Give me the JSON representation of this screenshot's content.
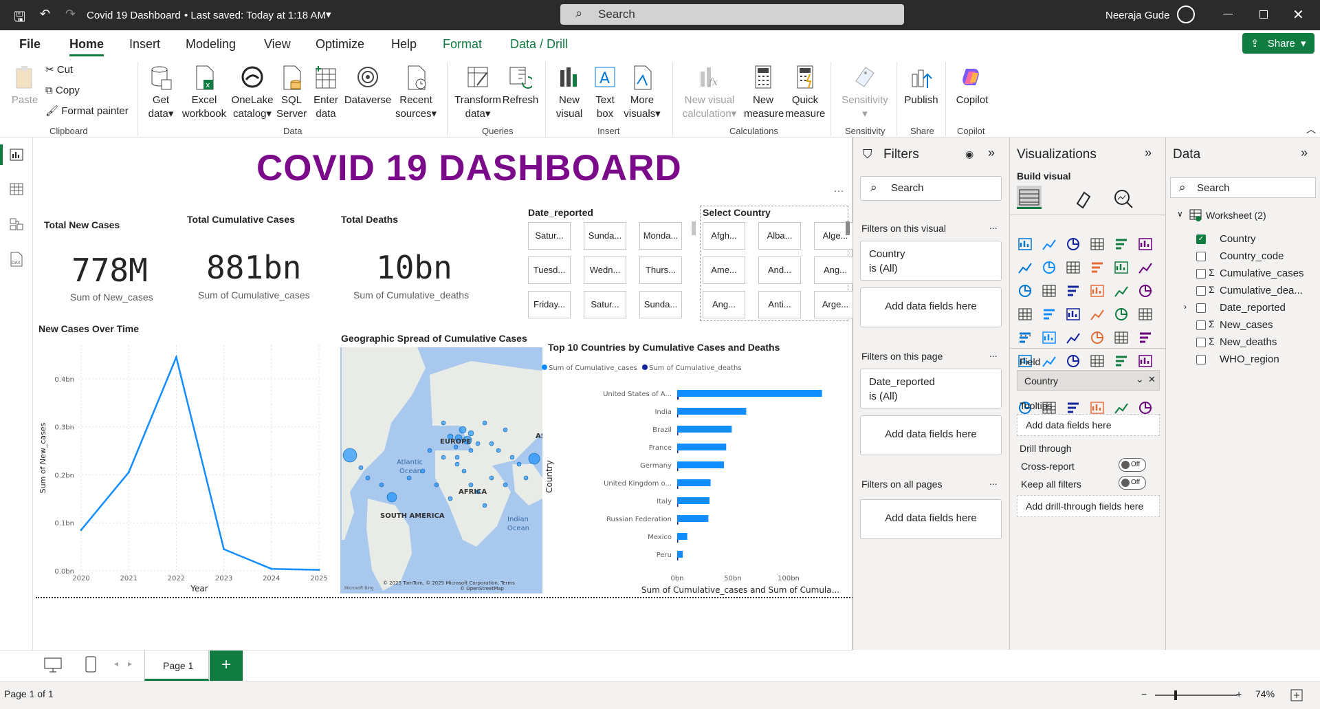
{
  "titlebar": {
    "doc_title": "Covid 19 Dashboard",
    "saved": "•  Last saved: Today at 1:18 AM",
    "search": "Search",
    "user": "Neeraja Gude"
  },
  "menu": {
    "file": "File",
    "home": "Home",
    "insert": "Insert",
    "modeling": "Modeling",
    "view": "View",
    "optimize": "Optimize",
    "help": "Help",
    "format": "Format",
    "data_drill": "Data / Drill",
    "share": "Share"
  },
  "ribbon": {
    "paste": "Paste",
    "cut": "Cut",
    "copy": "Copy",
    "format_painter": "Format painter",
    "clipboard": "Clipboard",
    "get_data": [
      "Get",
      "data"
    ],
    "excel": [
      "Excel",
      "workbook"
    ],
    "onelake": [
      "OneLake",
      "catalog"
    ],
    "sql": [
      "SQL",
      "Server"
    ],
    "enter_data": [
      "Enter",
      "data"
    ],
    "dataverse": "Dataverse",
    "recent": [
      "Recent",
      "sources"
    ],
    "data_group": "Data",
    "transform": [
      "Transform",
      "data"
    ],
    "refresh": "Refresh",
    "queries": "Queries",
    "new_visual": [
      "New",
      "visual"
    ],
    "text_box": [
      "Text",
      "box"
    ],
    "more_visuals": [
      "More",
      "visuals"
    ],
    "insert_group": "Insert",
    "new_visual_calc": [
      "New visual",
      "calculation"
    ],
    "new_measure": [
      "New",
      "measure"
    ],
    "quick_measure": [
      "Quick",
      "measure"
    ],
    "calc_group": "Calculations",
    "sensitivity": "Sensitivity",
    "sensitivity_group": "Sensitivity",
    "publish": "Publish",
    "share_group": "Share",
    "copilot": "Copilot",
    "copilot_group": "Copilot"
  },
  "report": {
    "title": "COVID 19 DASHBOARD",
    "cards": [
      {
        "title": "Total New Cases",
        "value": "778M",
        "sub": "Sum of New_cases"
      },
      {
        "title": "Total Cumulative Cases",
        "value": "881bn",
        "sub": "Sum of Cumulative_cases"
      },
      {
        "title": "Total Deaths",
        "value": "10bn",
        "sub": "Sum of Cumulative_deaths"
      }
    ],
    "date_slicer": {
      "title": "Date_reported",
      "items": [
        "Satur...",
        "Sunda...",
        "Monda...",
        "Tuesd...",
        "Wedn...",
        "Thurs...",
        "Friday...",
        "Satur...",
        "Sunda..."
      ]
    },
    "country_slicer": {
      "title": "Select Country",
      "items": [
        "Afgh...",
        "Alba...",
        "Alge...",
        "Ame...",
        "And...",
        "Ang...",
        "Ang...",
        "Anti...",
        "Arge..."
      ]
    },
    "map": {
      "title": "Geographic Spread of Cumulative Cases",
      "labels": [
        "EUROPE",
        "AS",
        "Atlantic",
        "Ocean",
        "AFRICA",
        "SOUTH AMERICA",
        "Indian",
        "Ocean"
      ],
      "credit": "© 2025 TomTom, © 2025 Microsoft Corporation, Terms",
      "credit2": "© OpenStreetMap",
      "bing": "Microsoft Bing"
    }
  },
  "chart_data": [
    {
      "type": "line",
      "title": "New Cases Over Time",
      "xlabel": "Year",
      "ylabel": "Sum of New_cases",
      "x": [
        "2020",
        "2021",
        "2022",
        "2023",
        "2024",
        "2025"
      ],
      "values": [
        0.085,
        0.205,
        0.445,
        0.045,
        0.004,
        0.002
      ],
      "unit": "bn",
      "yticks": [
        "0.0bn",
        "0.1bn",
        "0.2bn",
        "0.3bn",
        "0.4bn"
      ],
      "ylim": [
        0,
        0.47
      ],
      "color": "#118dff"
    },
    {
      "type": "bar",
      "title": "Top 10 Countries by Cumulative Cases and Deaths",
      "xlabel": "Sum of Cumulative_cases and Sum of Cumula...",
      "ylabel": "Country",
      "categories": [
        "United States of A...",
        "India",
        "Brazil",
        "France",
        "Germany",
        "United Kingdom o...",
        "Italy",
        "Russian Federation",
        "Mexico",
        "Peru"
      ],
      "series": [
        {
          "name": "Sum of Cumulative_cases",
          "values": [
            130,
            62,
            49,
            44,
            42,
            30,
            29,
            28,
            9,
            5
          ],
          "color": "#118dff"
        },
        {
          "name": "Sum of Cumulative_deaths",
          "values": [
            1.4,
            0.6,
            0.8,
            0.2,
            0.2,
            0.2,
            0.2,
            0.4,
            0.4,
            0.25
          ],
          "color": "#12239e"
        }
      ],
      "xticks": [
        "0bn",
        "50bn",
        "100bn"
      ],
      "xlim": [
        0,
        150
      ],
      "unit": "bn"
    }
  ],
  "filters": {
    "title": "Filters",
    "search": "Search",
    "on_visual": "Filters on this visual",
    "f1_field": "Country",
    "f1_state": "is (All)",
    "add": "Add data fields here",
    "on_page": "Filters on this page",
    "f2_field": "Date_reported",
    "f2_state": "is (All)",
    "all_pages": "Filters on all pages",
    "more": "..."
  },
  "viz": {
    "title": "Visualizations",
    "build": "Build visual",
    "field_label": "Field",
    "field_value": "Country",
    "tooltips": "Tooltips",
    "add": "Add data fields here",
    "drill": "Drill through",
    "cross": "Cross-report",
    "keep": "Keep all filters",
    "off": "Off",
    "add_drill": "Add drill-through fields here",
    "more": "..."
  },
  "datapane": {
    "title": "Data",
    "search": "Search",
    "table": "Worksheet (2)",
    "fields": [
      {
        "name": "Country",
        "checked": true,
        "sigma": false
      },
      {
        "name": "Country_code",
        "checked": false,
        "sigma": false
      },
      {
        "name": "Cumulative_cases",
        "checked": false,
        "sigma": true
      },
      {
        "name": "Cumulative_dea...",
        "checked": false,
        "sigma": true
      },
      {
        "name": "Date_reported",
        "checked": false,
        "sigma": false
      },
      {
        "name": "New_cases",
        "checked": false,
        "sigma": true
      },
      {
        "name": "New_deaths",
        "checked": false,
        "sigma": true
      },
      {
        "name": "WHO_region",
        "checked": false,
        "sigma": false
      }
    ]
  },
  "bottom": {
    "page_tab": "Page 1",
    "page_status": "Page 1 of 1",
    "zoom": "74%"
  }
}
